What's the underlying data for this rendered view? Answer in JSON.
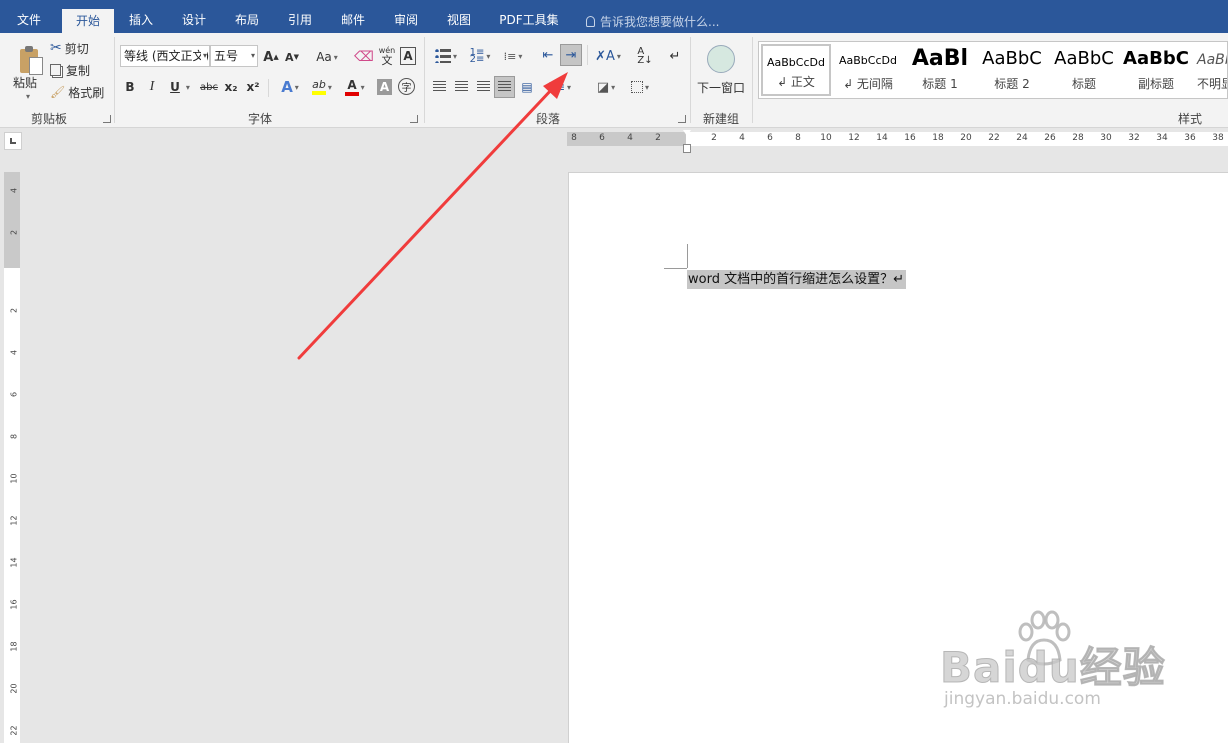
{
  "tabs": [
    "文件",
    "开始",
    "插入",
    "设计",
    "布局",
    "引用",
    "邮件",
    "审阅",
    "视图",
    "PDF工具集"
  ],
  "active_tab": "开始",
  "tell_me": "告诉我您想要做什么...",
  "clipboard": {
    "paste": "粘贴",
    "cut": "剪切",
    "copy": "复制",
    "format_painter": "格式刷",
    "label": "剪贴板"
  },
  "font": {
    "font_name": "等线 (西文正文)",
    "font_size": "五号",
    "grow": "A",
    "shrink": "A",
    "case": "Aa",
    "phonetic": "wén",
    "phonetic_char": "文",
    "border_char": "A",
    "bold": "B",
    "italic": "I",
    "underline": "U",
    "strike": "abc",
    "sub": "x₂",
    "sup": "x²",
    "effects": "A",
    "highlight": "ab",
    "color": "A",
    "shade": "A",
    "enclose": "字",
    "label": "字体"
  },
  "paragraph": {
    "label": "段落"
  },
  "new_group": {
    "button": "下一窗口",
    "label": "新建组"
  },
  "styles": {
    "items": [
      {
        "sample": "AaBbCcDd",
        "name": "↲ 正文"
      },
      {
        "sample": "AaBbCcDd",
        "name": "↲ 无间隔"
      },
      {
        "sample": "AaBl",
        "name": "标题 1"
      },
      {
        "sample": "AaBbC",
        "name": "标题 2"
      },
      {
        "sample": "AaBbC",
        "name": "标题"
      },
      {
        "sample": "AaBbC",
        "name": "副标题"
      },
      {
        "sample": "AaBbC",
        "name": "不明显"
      }
    ],
    "label": "样式"
  },
  "ruler": {
    "left_numbers": [
      "8",
      "6",
      "4",
      "2"
    ],
    "right_numbers": [
      "2",
      "4",
      "6",
      "8",
      "10",
      "12",
      "14",
      "16",
      "18",
      "20",
      "22",
      "24",
      "26",
      "28",
      "30",
      "32",
      "34",
      "36",
      "38"
    ],
    "vertical_numbers": [
      "4",
      "2",
      "2",
      "4",
      "6",
      "8",
      "10",
      "12",
      "14",
      "16",
      "18",
      "20",
      "22"
    ]
  },
  "document": {
    "line": "word 文档中的首行缩进怎么设置？↵"
  },
  "watermark": {
    "logo": "Baidu经验",
    "url": "jingyan.baidu.com"
  },
  "colors": {
    "tabbar": "#2b579a",
    "ribbon": "#f3f3f3",
    "arrow": "#f03c3c",
    "highlight": "#ffff00",
    "font_color": "#e00000"
  }
}
